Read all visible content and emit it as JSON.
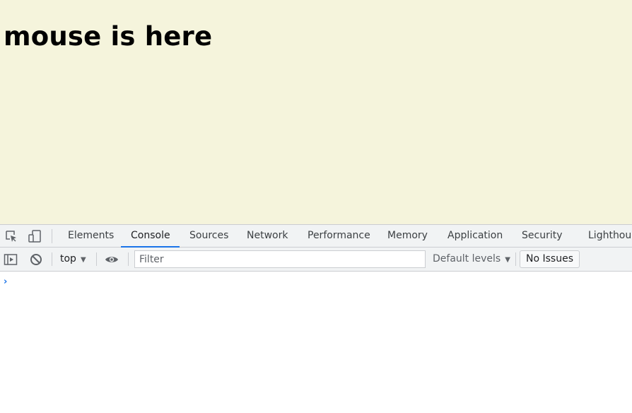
{
  "page": {
    "heading": "mouse is here",
    "background": "#f5f4dc"
  },
  "devtools": {
    "icons": {
      "inspect": "inspect-element-icon",
      "device": "device-toolbar-icon"
    },
    "tabs": [
      {
        "label": "Elements"
      },
      {
        "label": "Console",
        "active": true
      },
      {
        "label": "Sources"
      },
      {
        "label": "Network"
      },
      {
        "label": "Performance"
      },
      {
        "label": "Memory"
      },
      {
        "label": "Application"
      },
      {
        "label": "Security"
      },
      {
        "label": "Lighthouse"
      }
    ],
    "toolbar": {
      "context": "top",
      "filter_placeholder": "Filter",
      "levels": "Default levels",
      "issues": "No Issues"
    },
    "console": {
      "prompt": "›"
    },
    "accent_color": "#1a73e8"
  }
}
